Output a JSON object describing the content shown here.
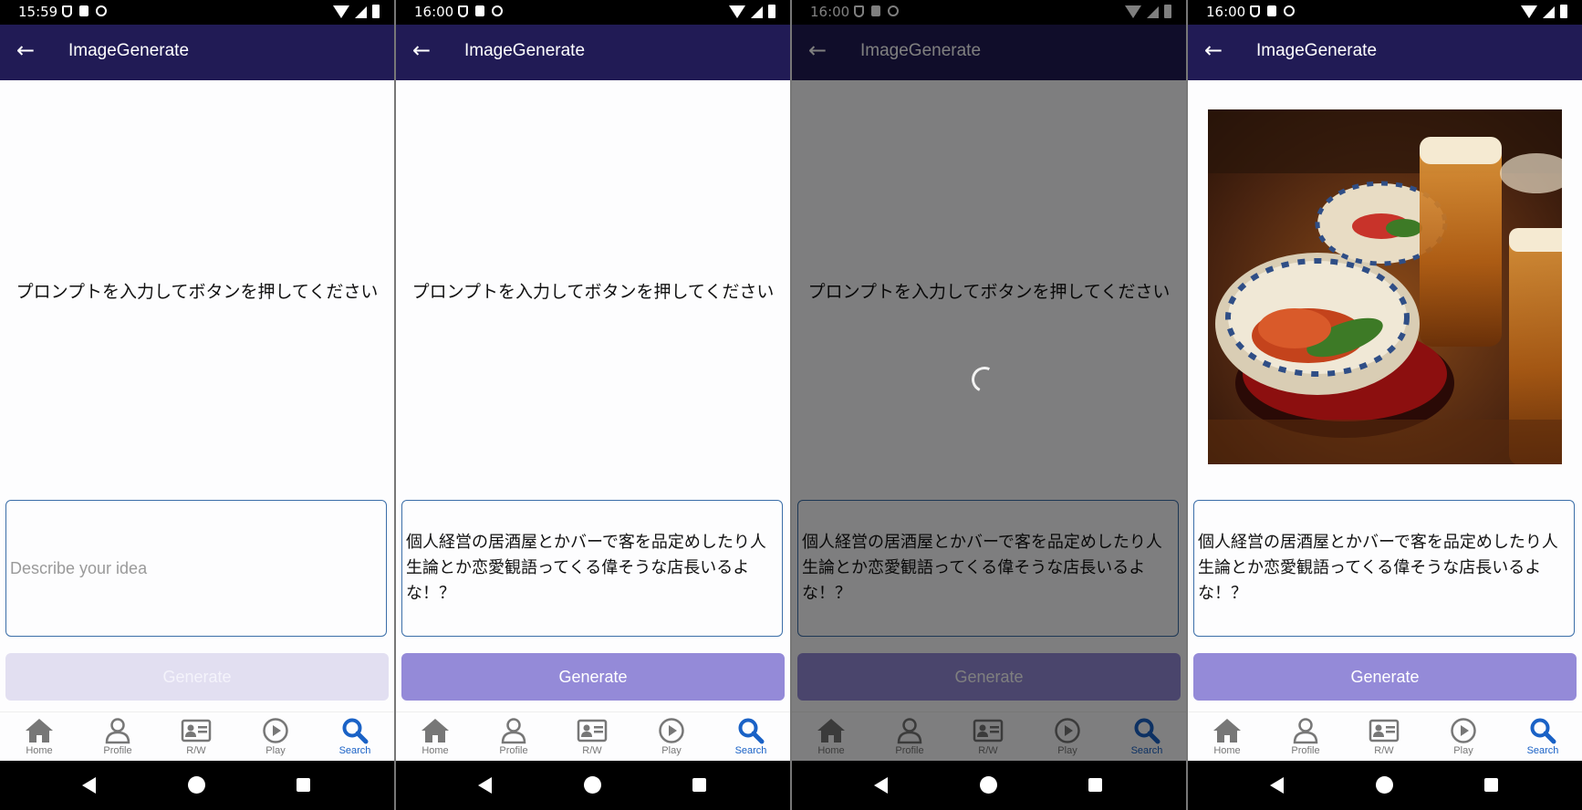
{
  "screens": [
    {
      "status": {
        "time": "15:59"
      },
      "appbar": {
        "back_icon": "←",
        "title": "ImageGenerate"
      },
      "message": "プロンプトを入力してボタンを押してください",
      "prompt": {
        "value": "",
        "placeholder": "Describe your idea"
      },
      "generate_label": "Generate",
      "generate_enabled": false,
      "loading": false,
      "has_image": false
    },
    {
      "status": {
        "time": "16:00"
      },
      "appbar": {
        "back_icon": "←",
        "title": "ImageGenerate"
      },
      "message": "プロンプトを入力してボタンを押してください",
      "prompt": {
        "value": "個人経営の居酒屋とかバーで客を品定めしたり人生論とか恋愛観語ってくる偉そうな店長いるよな！？",
        "placeholder": "Describe your idea"
      },
      "generate_label": "Generate",
      "generate_enabled": true,
      "loading": false,
      "has_image": false
    },
    {
      "status": {
        "time": "16:00"
      },
      "appbar": {
        "back_icon": "←",
        "title": "ImageGenerate"
      },
      "message": "プロンプトを入力してボタンを押してください",
      "prompt": {
        "value": "個人経営の居酒屋とかバーで客を品定めしたり人生論とか恋愛観語ってくる偉そうな店長いるよな！？",
        "placeholder": "Describe your idea"
      },
      "generate_label": "Generate",
      "generate_enabled": false,
      "loading": true,
      "has_image": false
    },
    {
      "status": {
        "time": "16:00"
      },
      "appbar": {
        "back_icon": "←",
        "title": "ImageGenerate"
      },
      "message": "",
      "prompt": {
        "value": "個人経営の居酒屋とかバーで客を品定めしたり人生論とか恋愛観語ってくる偉そうな店長いるよな！？",
        "placeholder": "Describe your idea"
      },
      "generate_label": "Generate",
      "generate_enabled": true,
      "loading": false,
      "has_image": true
    }
  ],
  "bottom_nav": [
    {
      "label": "Home",
      "icon": "home-icon",
      "active": false
    },
    {
      "label": "Profile",
      "icon": "profile-icon",
      "active": false
    },
    {
      "label": "R/W",
      "icon": "id-card-icon",
      "active": false
    },
    {
      "label": "Play",
      "icon": "play-icon",
      "active": false
    },
    {
      "label": "Search",
      "icon": "search-icon",
      "active": true
    }
  ],
  "colors": {
    "appbar_bg": "#211b55",
    "button_enabled": "#948ad8",
    "button_disabled": "#e2dff1",
    "nav_active": "#1a62c6",
    "prompt_border": "#3b6ea8"
  }
}
